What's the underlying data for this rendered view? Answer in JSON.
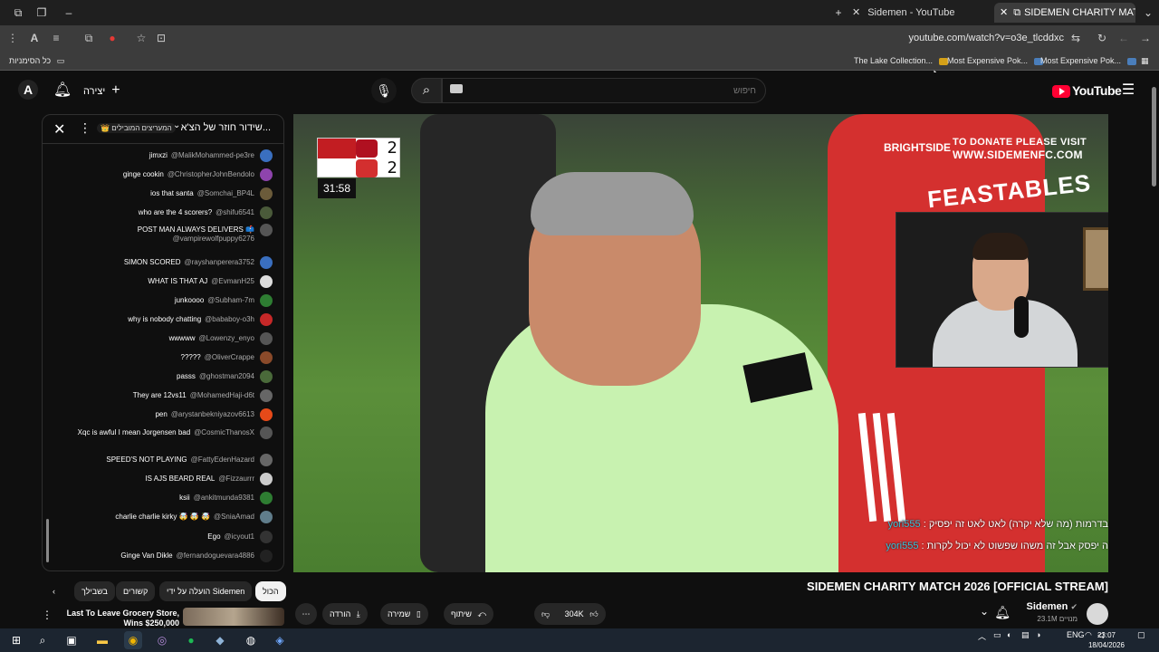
{
  "browser": {
    "tabs": [
      {
        "label": "Sidemen - YouTube"
      },
      {
        "label": "SIDEMEN CHARITY MATCH"
      }
    ],
    "url": "youtube.com/watch?v=o3e_tlcddxc",
    "bookmarks_all_label": "כל הסימניות",
    "bookmarks": [
      "The Lake Collection...",
      "Most Expensive Pok...",
      "Most Expensive Pok..."
    ]
  },
  "masthead": {
    "create_label": "יצירה",
    "search_placeholder": "חיפוש",
    "logo_text": "YouTube",
    "avatar_letter": "A"
  },
  "chat": {
    "title": "שידור חוזר של הצ'א...",
    "mode_label": "👑 המעריצים המובילים",
    "messages": [
      {
        "text": "jimxzi",
        "author": "@MalikMohammed-pe3re",
        "color": "#3a6fbf"
      },
      {
        "text": "ginge cookin",
        "author": "@ChristopherJohnBendolo",
        "color": "#8e44ad"
      },
      {
        "text": "ios that santa",
        "author": "@Somchai_BP4L",
        "color": "#6b5b3a"
      },
      {
        "text": "who are the 4 scorers?",
        "author": "@shifu6541",
        "color": "#4a5a3a"
      },
      {
        "text": "POST MAN ALWAYS DELIVERS 📫",
        "author": "@vampirewolfpuppy6276",
        "color": "#555"
      },
      {
        "text": "SIMON SCORED",
        "author": "@rayshanperera3752",
        "color": "#3a6fbf"
      },
      {
        "text": "WHAT IS THAT AJ",
        "author": "@EvmanH25",
        "color": "#ddd"
      },
      {
        "text": "junkoooo",
        "author": "@Subham-7m",
        "color": "#2e7d32"
      },
      {
        "text": "why is nobody chatting",
        "author": "@bababoy-o3h",
        "color": "#c62828"
      },
      {
        "text": "wwwww",
        "author": "@Lowenzy_enyo",
        "color": "#555"
      },
      {
        "text": "?????",
        "author": "@OliverCrappe",
        "color": "#8a4a2a"
      },
      {
        "text": "passs",
        "author": "@ghostman2094",
        "color": "#4a6a3a"
      },
      {
        "text": "They are 12vs11",
        "author": "@MohamedHaji-d6t",
        "color": "#666"
      },
      {
        "text": "pen",
        "author": "@arystanbekniyazov6613",
        "color": "#e64a19"
      },
      {
        "text": "Xqc is awful I mean Jorgensen bad",
        "author": "@CosmicThanosX",
        "color": "#555"
      },
      {
        "text": "SPEED'S NOT PLAYING",
        "author": "@FattyEdenHazard",
        "color": "#666"
      },
      {
        "text": "IS AJS BEARD REAL",
        "author": "@Fizzaurrr",
        "color": "#ccc"
      },
      {
        "text": "ksii",
        "author": "@ankitmunda9381",
        "color": "#2e7d32"
      },
      {
        "text": "charlie charlie kirky 🤯 🤯 🤯",
        "author": "@SniaAmad",
        "color": "#607d8b"
      },
      {
        "text": "Ego",
        "author": "@icyout1",
        "color": "#333"
      },
      {
        "text": "Ginge Van Dikle",
        "author": "@fernandoguevara4886",
        "color": "#222"
      }
    ]
  },
  "video": {
    "score_home": "2",
    "score_away": "2",
    "match_time": "31:58",
    "donate_line1": "TO DONATE PLEASE VISIT",
    "donate_line2": "WWW.SIDEMENFC.COM",
    "brightside": "BRIGHTSIDE",
    "feastables": "FEASTABLES",
    "overlay_chat": [
      {
        "user": "yori555",
        "text": ": בדרמות (מה שלא יקרה) לאט לאט זה יפסיק"
      },
      {
        "user": "yori555",
        "text": ": ה יפסק אבל זה משהו שפשוט לא יכול לקרות"
      }
    ]
  },
  "below_video": {
    "title": "SIDEMEN CHARITY MATCH 2026 [OFFICIAL STREAM]",
    "channel_name": "Sidemen",
    "subscribers": "23.1M מנויים",
    "likes": "304K",
    "share_label": "שיתוף",
    "save_label": "שמירה",
    "download_label": "הורדה",
    "chips": [
      "הכול",
      "הועלה על ידי Sidemen",
      "קשורים",
      "בשבילך"
    ],
    "rec_title": "Last To Leave Grocery Store, Wins $250,000"
  },
  "taskbar": {
    "lang": "ENG",
    "time": "23:07",
    "date": "18/04/2026"
  },
  "colors": {
    "bg": "#0f0f0f",
    "yt_red": "#ff0033",
    "overlay_user": "#35c4dc"
  }
}
